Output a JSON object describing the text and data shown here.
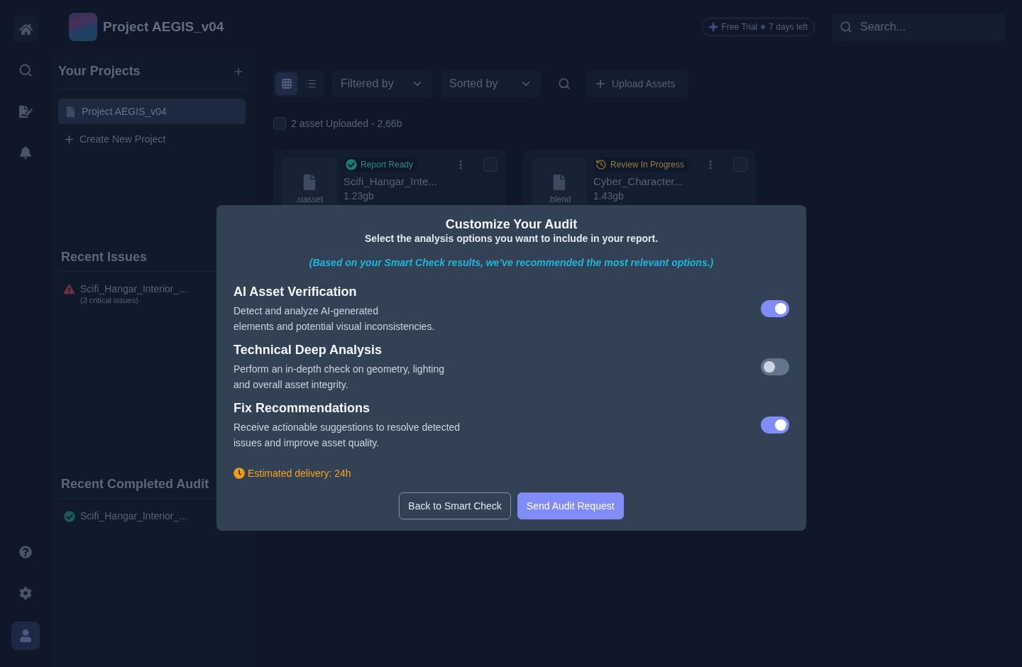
{
  "header": {
    "project_title": "Project AEGIS_v04",
    "trial_badge": {
      "label": "Free Trial",
      "remaining": "7 days left"
    },
    "search": {
      "placeholder": "Search..."
    }
  },
  "projects_panel": {
    "title": "Your Projects",
    "projects": [
      {
        "name": "Project AEGIS_v04",
        "selected": true
      }
    ],
    "create_label": "Create New Project"
  },
  "recent_issues": {
    "title": "Recent Issues",
    "items": [
      {
        "name": "Scifi_Hangar_Interior_...",
        "detail": "(3 critical issues)"
      }
    ]
  },
  "recent_completed": {
    "title": "Recent Completed Audit",
    "items": [
      {
        "name": "Scifi_Hangar_Interior_..."
      }
    ]
  },
  "toolbar": {
    "views": [
      {
        "kind": "grid",
        "selected": true
      },
      {
        "kind": "list",
        "selected": false
      }
    ],
    "filter": {
      "label": "Filtered by"
    },
    "sort": {
      "label": "Sorted by"
    },
    "upload_label": "Upload Assets"
  },
  "assets": {
    "select_all": {
      "checked": false,
      "label": "2 asset Uploaded - 2,66b"
    },
    "cards": [
      {
        "extension": ".uasset",
        "status": {
          "kind": "ready",
          "label": "Report Ready"
        },
        "name": "Scifi_Hangar_Inte...",
        "size": "1.23gb",
        "checked": false
      },
      {
        "extension": ".blend",
        "status": {
          "kind": "in_progress",
          "label": "Review In Progress"
        },
        "name": "Cyber_Character...",
        "size": "1.43gb",
        "checked": false
      }
    ]
  },
  "modal": {
    "title": "Customize Your Audit",
    "subtitle": "Select the analysis options you want to include in your report.",
    "note": "(Based on your Smart Check results, we’ve recommended the most relevant options.)",
    "options": [
      {
        "title": "AI Asset Verification",
        "description": "Detect and analyze AI-generated\nelements and potential visual inconsistencies.",
        "on": true
      },
      {
        "title": "Technical Deep Analysis",
        "description": "Perform an in-depth check on geometry, lighting\nand overall asset integrity.",
        "on": false
      },
      {
        "title": "Fix Recommendations",
        "description": "Receive actionable suggestions to resolve detected\nissues and improve asset quality.",
        "on": true
      }
    ],
    "estimate": "Estimated delivery: 24h",
    "buttons": [
      {
        "kind": "secondary",
        "label": "Back to Smart Check"
      },
      {
        "kind": "primary",
        "label": "Send Audit Request"
      }
    ]
  }
}
